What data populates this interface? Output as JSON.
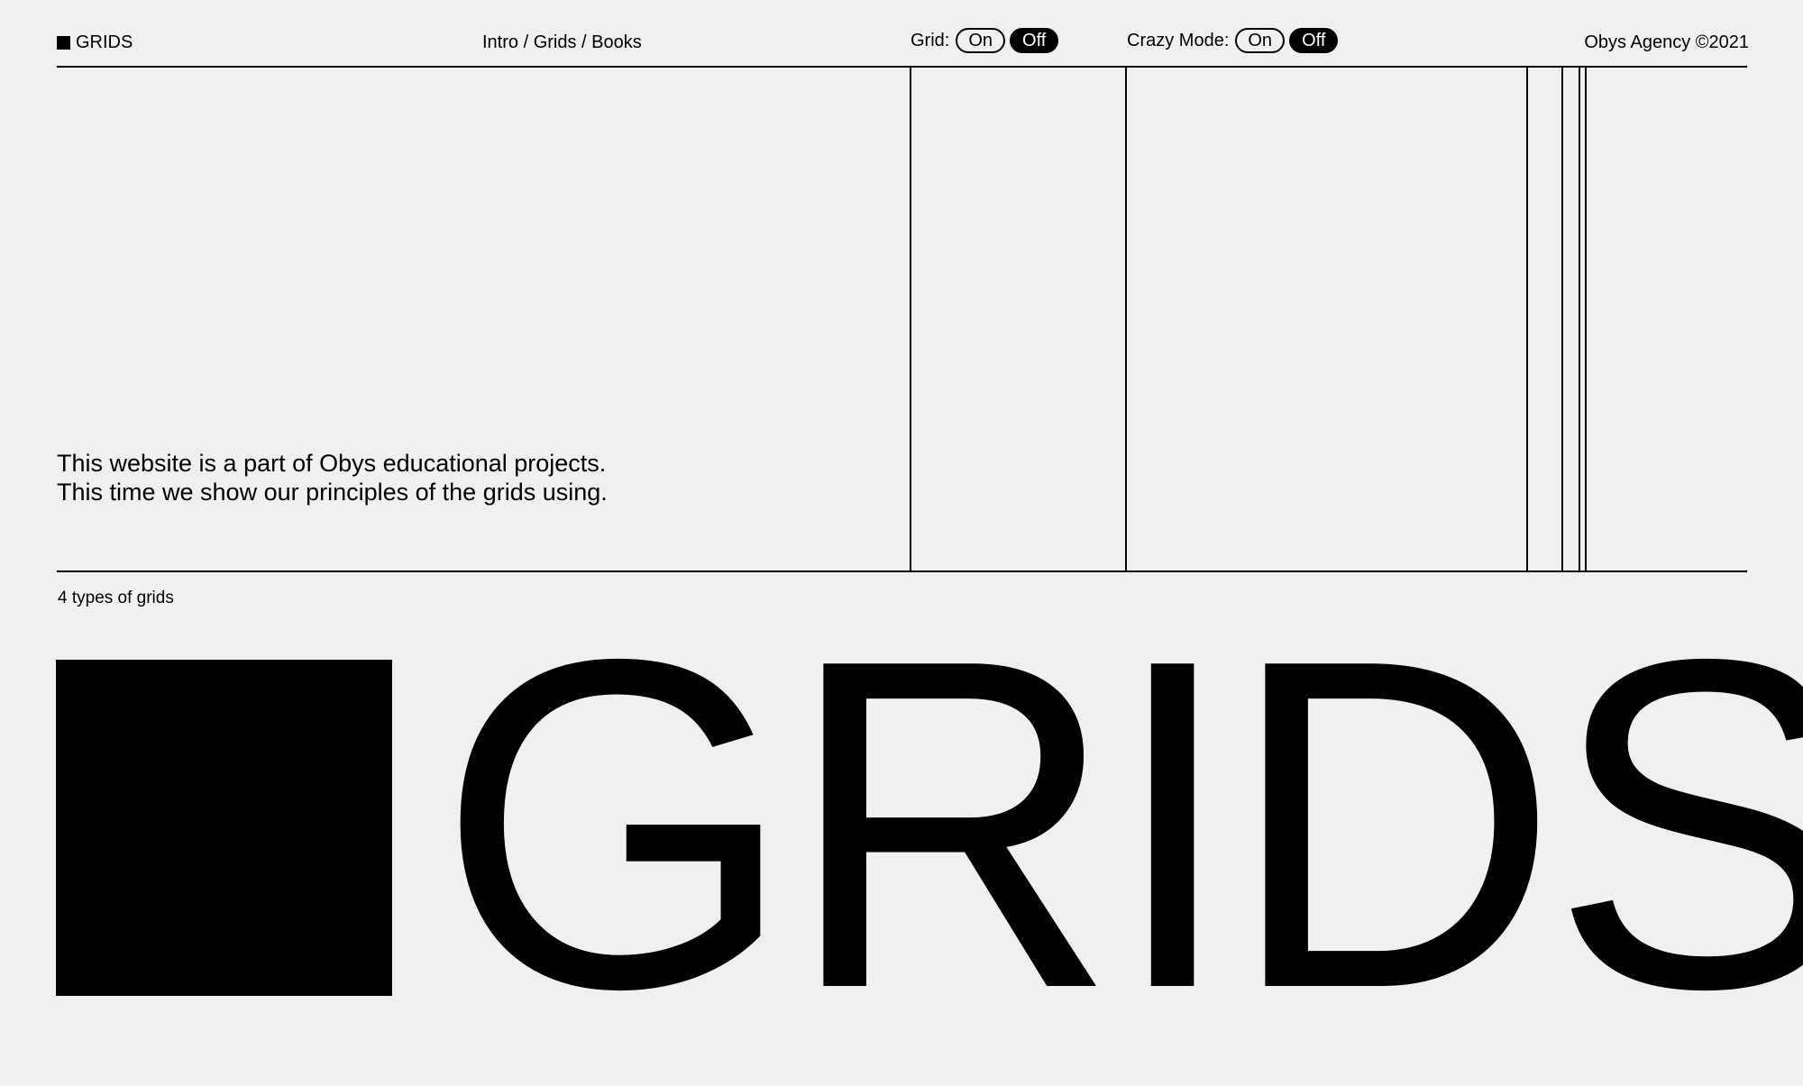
{
  "header": {
    "brand": "GRIDS",
    "breadcrumb": "Intro / Grids / Books",
    "grid_toggle": {
      "label": "Grid:",
      "on": "On",
      "off": "Off",
      "selected": "Off"
    },
    "crazy_toggle": {
      "label": "Crazy Mode:",
      "on": "On",
      "off": "Off",
      "selected": "Off"
    },
    "copyright": "Obys Agency ©2021"
  },
  "intro": {
    "line1": "This website is a part of Obys educational projects.",
    "line2": "This time we show our principles of the grids using."
  },
  "section": {
    "subheading": "4 types of grids",
    "title": "GRIDS"
  },
  "colors": {
    "background": "#f0f0f0",
    "foreground": "#000000"
  },
  "icons": {
    "brand": "square-icon",
    "hero": "square-icon"
  }
}
